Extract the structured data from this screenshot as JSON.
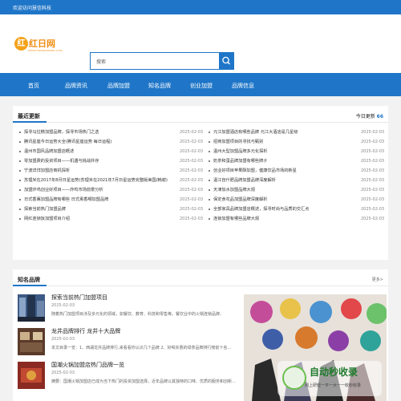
{
  "topbar": {
    "welcome": "欢迎访问慧信科技"
  },
  "logo": {
    "mark": "红",
    "name": "红日网",
    "sub": "WWW.HONGRIWANG.COM"
  },
  "search": {
    "placeholder": "搜索"
  },
  "nav": {
    "items": [
      "首页",
      "品牌资讯",
      "品牌加盟",
      "知名品牌",
      "创业加盟",
      "品牌信息"
    ]
  },
  "latest": {
    "title": "最近更新",
    "today_label": "今日更新",
    "today_count": "66",
    "left": [
      {
        "title": "探寻马拉糕加盟品牌，探寻市场热门之选",
        "date": "2025-02-03"
      },
      {
        "title": "腾讯星座今日运势大全(腾讯星座运势 每日运程)",
        "date": "2025-02-03"
      },
      {
        "title": "温州市国风品牌加盟店概述",
        "date": "2025-02-03"
      },
      {
        "title": "零加盟费的投资项目——机遇与挑战并存",
        "date": "2025-02-03"
      },
      {
        "title": "宁波烊烊加盟店商机探析",
        "date": "2025-02-03"
      },
      {
        "title": "苏理米在2017年8月日星运势(苏理米在2021年7月日星运势完整版美国/韩谢)",
        "date": "2025-02-03"
      },
      {
        "title": "加盟炸鸡创业好项目——炸鸡市场前景分析",
        "date": "2025-02-03"
      },
      {
        "title": "日式香薰加盟品牌有哪些 日式熏香哪加盟品牌",
        "date": "2025-02-03"
      },
      {
        "title": "探索当前热门加盟品牌",
        "date": "2025-02-03"
      },
      {
        "title": "网红连锁饭加盟项目介绍",
        "date": "2025-02-03"
      }
    ],
    "right": [
      {
        "title": "元江加盟酒店有哪些品牌 元江大酒店是几星级",
        "date": "2025-02-03"
      },
      {
        "title": "招商加盟项目的寻找与甄别",
        "date": "2025-02-03"
      },
      {
        "title": "温州大型加盟品牌多元化探析",
        "date": "2025-02-03"
      },
      {
        "title": "奶茶和蛋品牌加盟有哪些牌子",
        "date": "2025-02-03"
      },
      {
        "title": "创业好项目苹果酥加盟，健康饮品市场的新星",
        "date": "2025-02-03"
      },
      {
        "title": "温江自什肥品牌加盟品牌深度解析",
        "date": "2025-02-03"
      },
      {
        "title": "天津加水加盟品牌大观",
        "date": "2025-02-03"
      },
      {
        "title": "保定食花品加盟品牌深度解析",
        "date": "2025-02-03"
      },
      {
        "title": "全部家具品牌加盟店概述，探寻时尚与品质的交汇点",
        "date": "2025-02-03"
      },
      {
        "title": "连锁加盟有哪些品牌大观",
        "date": "2025-02-03"
      }
    ]
  },
  "brands": {
    "title": "知名品牌",
    "more": "更多>",
    "articles": [
      {
        "title": "探索当前热门加盟项目",
        "date": "2025-02-03",
        "summary": "随着热门加盟项目涉及多元化的领域，如餐饮、教育、科技和零售等。餐饮业中的火锅连锁品牌、"
      },
      {
        "title": "龙井品牌排行 龙井十大品牌",
        "date": "2025-02-03",
        "summary": "本文目录一览：1、西湖龙井品牌排行,来看看你认识几个品牌 2、好喝实惠的绿茶品牌排行榜前十名…"
      },
      {
        "title": "国潮火锅加盟店热门品牌一览",
        "date": "2025-02-03",
        "summary": "摘要：国潮火锅加盟店已成为当下热门的投资加盟选择，近年品牌以其独特的口味、优质的服务和创新…"
      }
    ],
    "watermark": {
      "big": "自动秒收录",
      "small": "网上研轻一平一大一一收秒收录"
    }
  },
  "colors": {
    "primary": "#1f76c8",
    "logo": "#f08c12"
  }
}
